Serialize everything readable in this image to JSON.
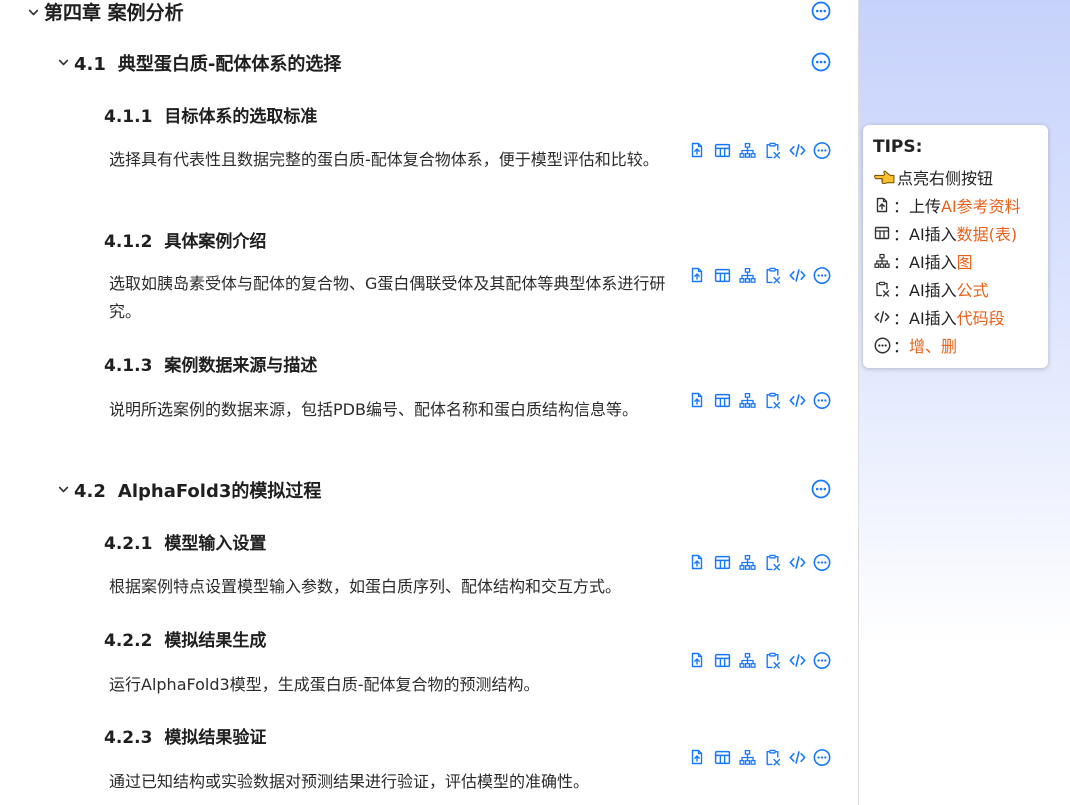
{
  "chapter": {
    "title": "第四章 案例分析"
  },
  "sections": [
    {
      "number": "4.1",
      "title": "典型蛋白质-配体体系的选择",
      "subsections": [
        {
          "number": "4.1.1",
          "title": "目标体系的选取标准",
          "text": "选择具有代表性且数据完整的蛋白质-配体复合物体系，便于模型评估和比较。"
        },
        {
          "number": "4.1.2",
          "title": "具体案例介绍",
          "text": "选取如胰岛素受体与配体的复合物、G蛋白偶联受体及其配体等典型体系进行研究。"
        },
        {
          "number": "4.1.3",
          "title": "案例数据来源与描述",
          "text": "说明所选案例的数据来源，包括PDB编号、配体名称和蛋白质结构信息等。"
        }
      ]
    },
    {
      "number": "4.2",
      "title": "AlphaFold3的模拟过程",
      "subsections": [
        {
          "number": "4.2.1",
          "title": "模型输入设置",
          "text": "根据案例特点设置模型输入参数，如蛋白质序列、配体结构和交互方式。"
        },
        {
          "number": "4.2.2",
          "title": "模拟结果生成",
          "text": "运行AlphaFold3模型，生成蛋白质-配体复合物的预测结构。"
        },
        {
          "number": "4.2.3",
          "title": "模拟结果验证",
          "text": "通过已知结构或实验数据对预测结果进行验证，评估模型的准确性。"
        }
      ]
    }
  ],
  "toolbar_icons": [
    "upload-file-icon",
    "table-icon",
    "diagram-icon",
    "formula-icon",
    "code-icon",
    "more-icon"
  ],
  "tips": {
    "title": "TIPS:",
    "hint": "点亮右侧按钮",
    "rows": [
      {
        "icon": "upload-file-icon",
        "prefix": "：上传",
        "highlight": "AI参考资料"
      },
      {
        "icon": "table-icon",
        "prefix": "：AI插入",
        "highlight": "数据(表)"
      },
      {
        "icon": "diagram-icon",
        "prefix": "：AI插入",
        "highlight": "图"
      },
      {
        "icon": "formula-icon",
        "prefix": "：AI插入",
        "highlight": "公式"
      },
      {
        "icon": "code-icon",
        "prefix": "：AI插入",
        "highlight": "代码段"
      },
      {
        "icon": "more-icon",
        "prefix": "：",
        "highlight": "增、删"
      }
    ]
  },
  "colors": {
    "icon_blue": "#1677ff",
    "highlight_orange": "#e8611a",
    "panel_gradient_top": "#c7d2fb"
  }
}
